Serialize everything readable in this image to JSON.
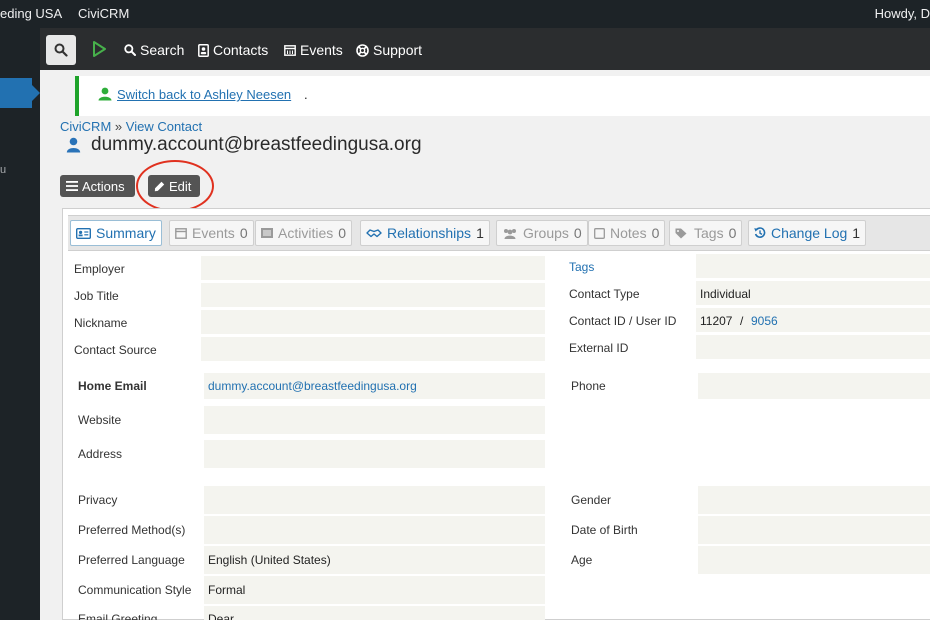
{
  "adminbar": {
    "site": "eding USA",
    "civicrm": "CiviCRM",
    "howdy": "Howdy, D"
  },
  "sidebar": {
    "glyph": "u"
  },
  "civimenu": {
    "search": "Search",
    "contacts": "Contacts",
    "events": "Events",
    "support": "Support"
  },
  "notice": {
    "link_text": "Switch back to Ashley Neesen",
    "suffix": "."
  },
  "breadcrumb": {
    "root": "CiviCRM",
    "sep": "»",
    "current": "View Contact"
  },
  "contact": {
    "display_name": "dummy.account@breastfeedingusa.org"
  },
  "actions": {
    "actions_label": "Actions",
    "edit_label": "Edit"
  },
  "tabs": [
    {
      "label": "Summary",
      "count": ""
    },
    {
      "label": "Events",
      "count": "0"
    },
    {
      "label": "Activities",
      "count": "0"
    },
    {
      "label": "Relationships",
      "count": "1"
    },
    {
      "label": "Groups",
      "count": "0"
    },
    {
      "label": "Notes",
      "count": "0"
    },
    {
      "label": "Tags",
      "count": "0"
    },
    {
      "label": "Change Log",
      "count": "1"
    }
  ],
  "left_basic": {
    "employer": "Employer",
    "job_title": "Job Title",
    "nickname": "Nickname",
    "contact_source": "Contact Source"
  },
  "right_basic": {
    "tags": "Tags",
    "contact_type_label": "Contact Type",
    "contact_type_value": "Individual",
    "contact_id_label": "Contact ID / User ID",
    "contact_id_value": "11207",
    "id_sep": "/",
    "user_id_value": "9056",
    "external_id": "External ID"
  },
  "contact_info": {
    "home_email_label": "Home Email",
    "home_email_value": "dummy.account@breastfeedingusa.org",
    "website": "Website",
    "address": "Address",
    "phone": "Phone"
  },
  "prefs": {
    "privacy": "Privacy",
    "preferred_method": "Preferred Method(s)",
    "preferred_language_label": "Preferred Language",
    "preferred_language_value": "English (United States)",
    "communication_style_label": "Communication Style",
    "communication_style_value": "Formal",
    "email_greeting_label": "Email Greeting",
    "email_greeting_value": "Dear"
  },
  "demographics": {
    "gender": "Gender",
    "date_of_birth": "Date of Birth",
    "age": "Age"
  },
  "colors": {
    "admin_bg": "#1d2327",
    "civi_bar": "#2b2d2f",
    "accent": "#2271b1",
    "notice_green": "#1ea32a",
    "highlight_red": "#e0311f"
  }
}
